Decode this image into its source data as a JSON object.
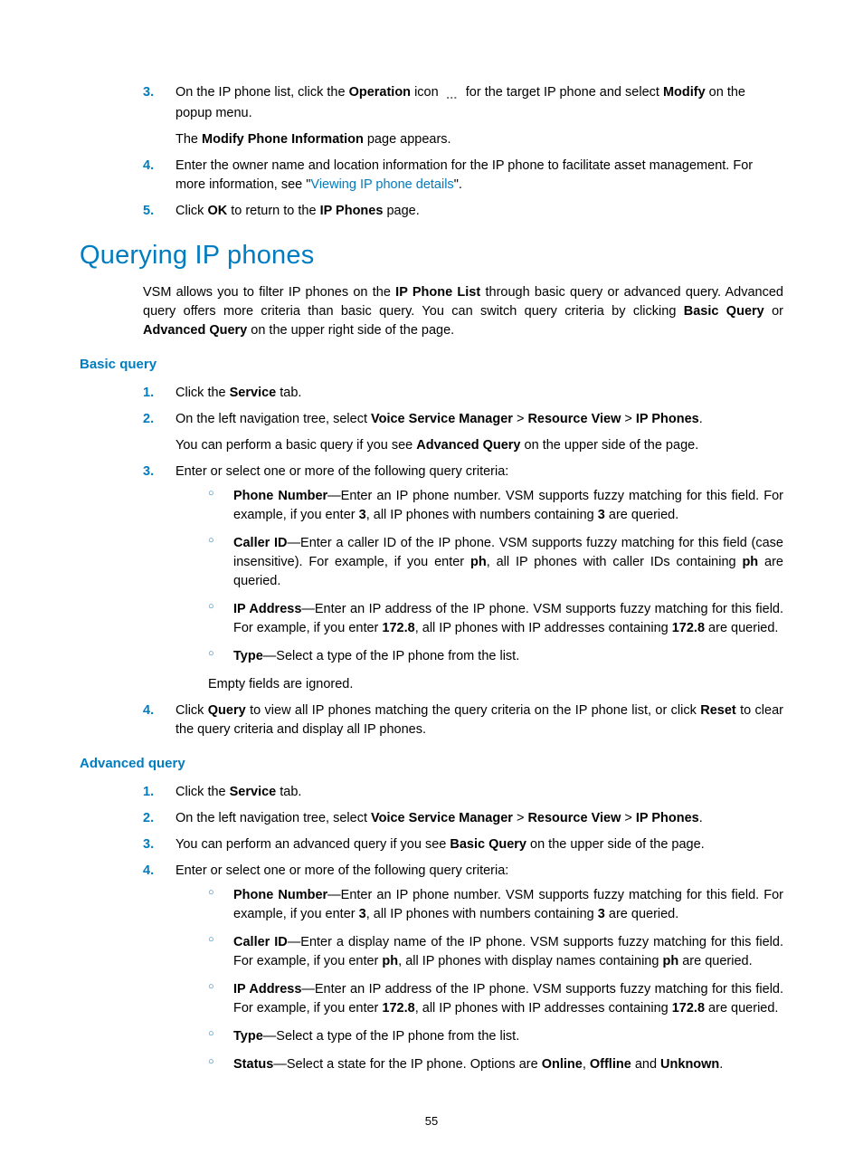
{
  "top": {
    "step3": {
      "num": "3.",
      "t1": "On the IP phone list, click the ",
      "b1": "Operation",
      "t2": " icon ",
      "icon": "…",
      "t3": " for the target IP phone and select ",
      "b2": "Modify",
      "t4": " on the popup menu."
    },
    "note3a": {
      "t1": "The ",
      "b1": "Modify Phone Information",
      "t2": " page appears."
    },
    "step4": {
      "num": "4.",
      "t1": "Enter the owner name and location information for the IP phone to facilitate asset management. For more information, see \"",
      "link": "Viewing IP phone details",
      "t2": "\"."
    },
    "step5": {
      "num": "5.",
      "t1": "Click ",
      "b1": "OK",
      "t2": " to return to the ",
      "b2": "IP Phones",
      "t3": " page."
    }
  },
  "h1": "Querying IP phones",
  "intro": {
    "t1": "VSM allows you to filter IP phones on the ",
    "b1": "IP Phone List",
    "t2": " through basic query or advanced query. Advanced query offers more criteria than basic query. You can switch query criteria by clicking ",
    "b2": "Basic Query",
    "t3": " or ",
    "b3": "Advanced Query",
    "t4": " on the upper right side of the page."
  },
  "basic": {
    "heading": "Basic query",
    "s1": {
      "num": "1.",
      "t1": "Click the ",
      "b1": "Service",
      "t2": " tab."
    },
    "s2": {
      "num": "2.",
      "t1": "On the left navigation tree, select ",
      "b1": "Voice Service Manager",
      "gt1": " > ",
      "b2": "Resource View",
      "gt2": " > ",
      "b3": "IP Phones",
      "t2": "."
    },
    "s2note": {
      "t1": "You can perform a basic query if you see ",
      "b1": "Advanced Query",
      "t2": " on the upper side of the page."
    },
    "s3": {
      "num": "3.",
      "t1": "Enter or select one or more of the following query criteria:"
    },
    "pn": {
      "b1": "Phone Number",
      "t1": "—Enter an IP phone number. VSM supports fuzzy matching for this field. For example, if you enter ",
      "b2": "3",
      "t2": ", all IP phones with numbers containing ",
      "b3": "3",
      "t3": " are queried."
    },
    "cid": {
      "b1": "Caller ID",
      "t1": "—Enter a caller ID of the IP phone. VSM supports fuzzy matching for this field (case insensitive). For example, if you enter ",
      "b2": "ph",
      "t2": ", all IP phones with caller IDs containing ",
      "b3": "ph",
      "t3": " are queried."
    },
    "ip": {
      "b1": "IP Address",
      "t1": "—Enter an IP address of the IP phone. VSM supports fuzzy matching for this field. For example, if you enter ",
      "b2": "172.8",
      "t2": ", all IP phones with IP addresses containing ",
      "b3": "172.8",
      "t3": " are queried."
    },
    "type": {
      "b1": "Type",
      "t1": "—Select a type of the IP phone from the list."
    },
    "empty": "Empty fields are ignored.",
    "s4": {
      "num": "4.",
      "t1": "Click ",
      "b1": "Query",
      "t2": " to view all IP phones matching the query criteria on the IP phone list, or click ",
      "b2": "Reset",
      "t3": " to clear the query criteria and display all IP phones."
    }
  },
  "adv": {
    "heading": "Advanced query",
    "s1": {
      "num": "1.",
      "t1": "Click the ",
      "b1": "Service",
      "t2": " tab."
    },
    "s2": {
      "num": "2.",
      "t1": "On the left navigation tree, select ",
      "b1": "Voice Service Manager",
      "gt1": " > ",
      "b2": "Resource View",
      "gt2": " > ",
      "b3": "IP Phones",
      "t2": "."
    },
    "s3": {
      "num": "3.",
      "t1": "You can perform an advanced query if you see ",
      "b1": "Basic Query",
      "t2": " on the upper side of the page."
    },
    "s4": {
      "num": "4.",
      "t1": "Enter or select one or more of the following query criteria:"
    },
    "pn": {
      "b1": "Phone Number",
      "t1": "—Enter an IP phone number. VSM supports fuzzy matching for this field. For example, if you enter ",
      "b2": "3",
      "t2": ", all IP phones with numbers containing ",
      "b3": "3",
      "t3": " are queried."
    },
    "cid": {
      "b1": "Caller ID",
      "t1": "—Enter a display name of the IP phone. VSM supports fuzzy matching for this field. For example, if you enter ",
      "b2": "ph",
      "t2": ", all IP phones with display names containing ",
      "b3": "ph",
      "t3": " are queried."
    },
    "ip": {
      "b1": "IP Address",
      "t1": "—Enter an IP address of the IP phone. VSM supports fuzzy matching for this field. For example, if you enter ",
      "b2": "172.8",
      "t2": ", all IP phones with IP addresses containing ",
      "b3": "172.8",
      "t3": " are queried."
    },
    "type": {
      "b1": "Type",
      "t1": "—Select a type of the IP phone from the list."
    },
    "status": {
      "b1": "Status",
      "t1": "—Select a state for the IP phone. Options are ",
      "b2": "Online",
      "t2": ", ",
      "b3": "Offline",
      "t3": " and ",
      "b4": "Unknown",
      "t4": "."
    }
  },
  "page_number": "55"
}
